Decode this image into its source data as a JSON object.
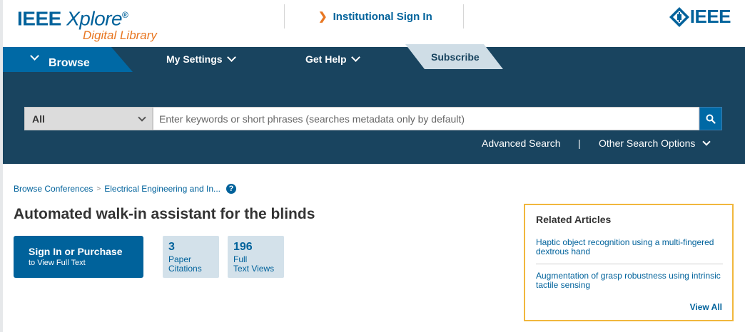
{
  "header": {
    "logo_main": "IEEE",
    "logo_sub_brand": "Xplore",
    "logo_registered": "®",
    "logo_tagline": "Digital Library",
    "institutional_sign_in": "Institutional Sign In",
    "ieee_logo": "IEEE"
  },
  "nav": {
    "browse": "Browse",
    "my_settings": "My Settings",
    "get_help": "Get Help",
    "subscribe": "Subscribe"
  },
  "search": {
    "scope_value": "All",
    "placeholder": "Enter keywords or short phrases (searches metadata only by default)",
    "advanced": "Advanced Search",
    "separator": "|",
    "other_options": "Other Search Options"
  },
  "breadcrumb": {
    "items": [
      "Browse Conferences",
      "Electrical Engineering and In..."
    ],
    "separator": ">",
    "help": "?"
  },
  "article": {
    "title": "Automated walk-in assistant for the blinds",
    "sign_in_label": "Sign In or Purchase",
    "sign_in_sub": "to View Full Text",
    "metrics": [
      {
        "value": "3",
        "label_line1": "Paper",
        "label_line2": "Citations"
      },
      {
        "value": "196",
        "label_line1": "Full",
        "label_line2": "Text Views"
      }
    ]
  },
  "related": {
    "heading": "Related Articles",
    "articles": [
      "Haptic object recognition using a multi-fingered dextrous hand",
      "Augmentation of grasp robustness using intrinsic tactile sensing"
    ],
    "view_all": "View All"
  },
  "colors": {
    "brand_blue": "#00629b",
    "nav_dark": "#19445f",
    "accent_orange": "#e87722",
    "related_border": "#f1b73d"
  },
  "icons": [
    "chevron-right-icon",
    "ieee-diamond-icon",
    "chevron-down-icon",
    "search-icon",
    "help-icon"
  ]
}
